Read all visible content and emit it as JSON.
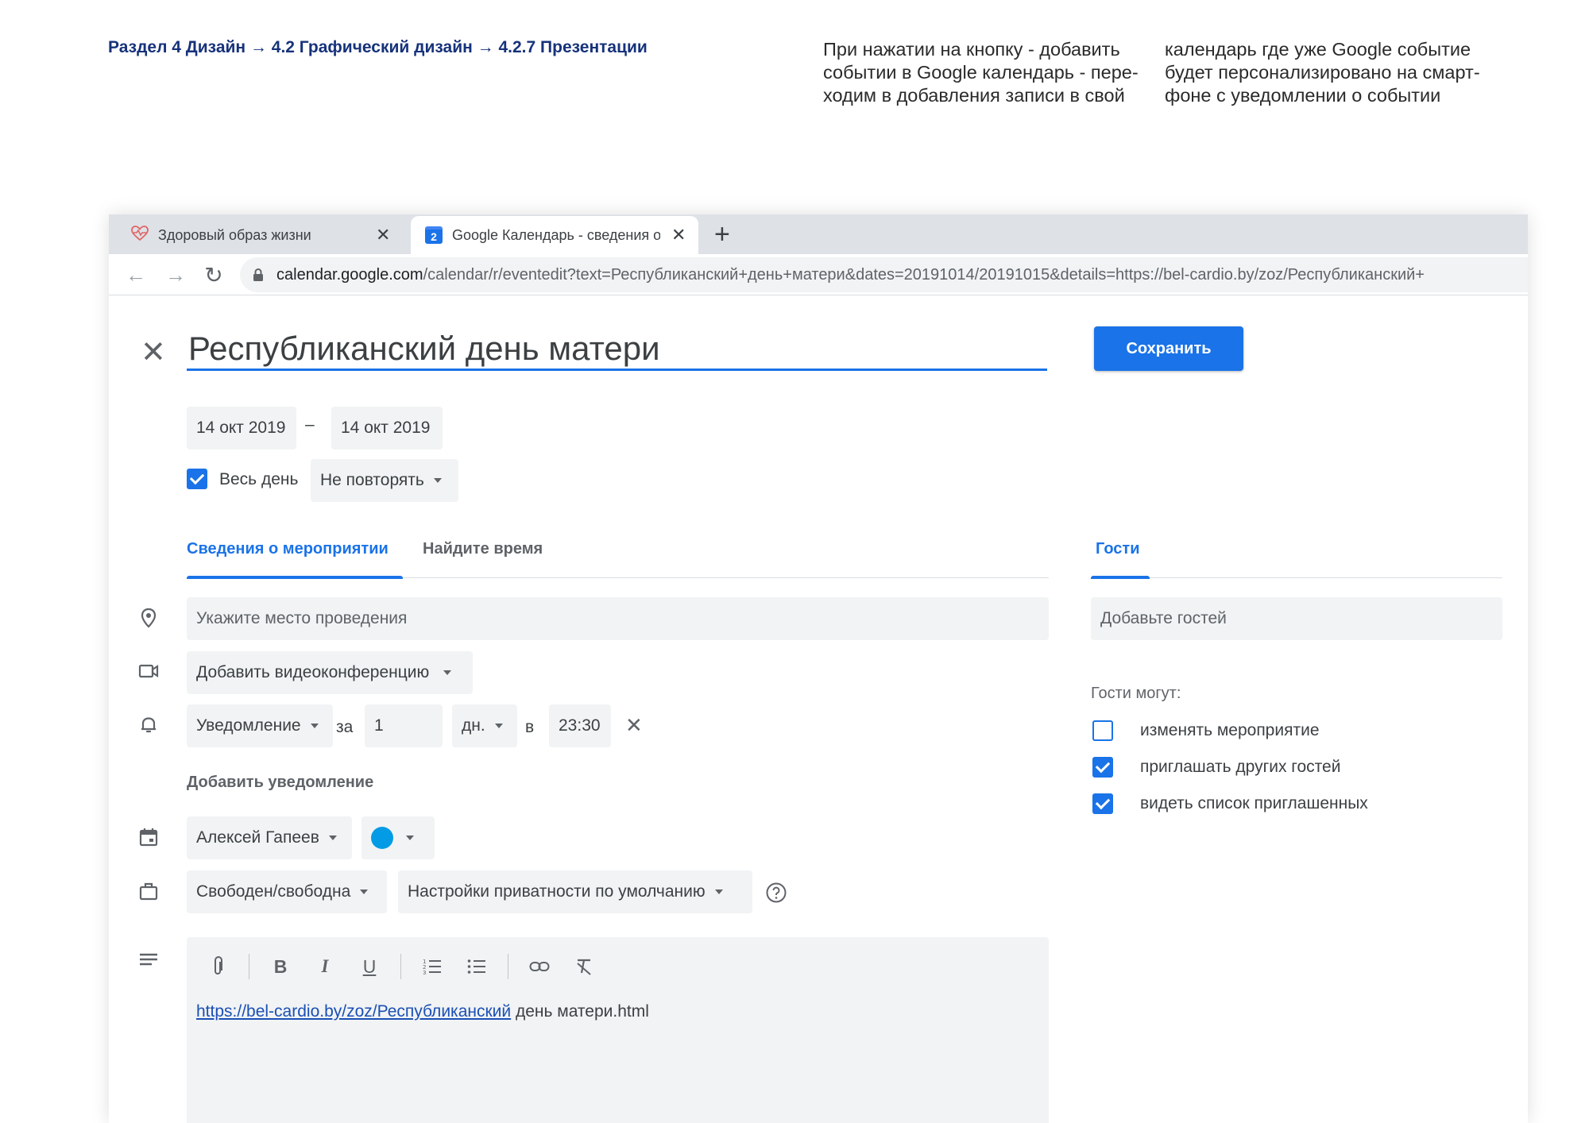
{
  "page": {
    "breadcrumb": "Раздел 4 Дизайн  → 4.2 Графический дизайн → 4.2.7 Презентации",
    "note_left": "При нажатии на кнопку - добавить\nсобытии в Google календарь - пере-\nходим в добавления записи в свой",
    "note_right": "календарь где уже Google событие\nбудет персонализировано на смарт-\nфоне с уведомлении о событии"
  },
  "browser": {
    "tabs": [
      {
        "title": "Здоровый образ жизни",
        "favicon": "heart-pulse-icon"
      },
      {
        "title": "Google Календарь - сведения о",
        "favicon": "google-calendar-icon",
        "favicon_text": "2"
      }
    ],
    "url_host": "calendar.google.com",
    "url_path": "/calendar/r/eventedit?text=Республиканский+день+матери&dates=20191014/20191015&details=https://bel-cardio.by/zoz/Республиканский+"
  },
  "event": {
    "title": "Республиканский день матери",
    "save_label": "Сохранить",
    "start_date": "14 окт 2019",
    "date_separator": "–",
    "end_date": "14 окт 2019",
    "all_day_label": "Весь день",
    "repeat": "Не повторять",
    "tabs": [
      "Сведения о мероприятии",
      "Найдите время"
    ],
    "location_placeholder": "Укажите место проведения",
    "conference_label": "Добавить видеоконференцию",
    "notification": {
      "type": "Уведомление",
      "before_label": "за",
      "amount": "1",
      "unit": "дн.",
      "at_label": "в",
      "time": "23:30"
    },
    "add_notification": "Добавить уведомление",
    "calendar_owner": "Алексей Гапеев",
    "event_color": "#039be5",
    "availability": "Свободен/свободна",
    "privacy": "Настройки приватности по умолчанию",
    "description_link": "https://bel-cardio.by/zoz/Республиканский",
    "description_rest": " день матери.html"
  },
  "guests": {
    "tab_label": "Гости",
    "add_placeholder": "Добавьте гостей",
    "permissions_title": "Гости могут:",
    "permissions": [
      {
        "label": "изменять мероприятие",
        "checked": false
      },
      {
        "label": "приглашать других гостей",
        "checked": true
      },
      {
        "label": "видеть список приглашенных",
        "checked": true
      }
    ]
  },
  "colors": {
    "accent": "#1a73e8",
    "breadcrumb": "#16327a"
  }
}
